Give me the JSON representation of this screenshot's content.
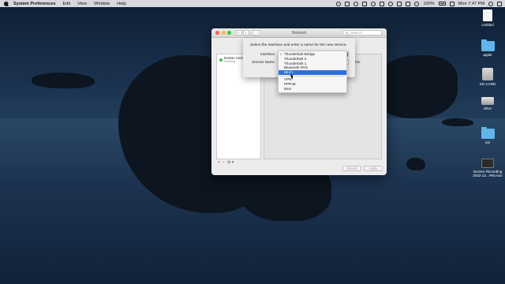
{
  "menubar": {
    "app_name": "System Preferences",
    "items": [
      "Edit",
      "View",
      "Window",
      "Help"
    ],
    "battery": "100%",
    "clock": "Mon 7:47 PM"
  },
  "desktop_icons": [
    {
      "label": "Untitled",
      "icon": "document-icon"
    },
    {
      "label": "apple",
      "icon": "folder-icon"
    },
    {
      "label": "SD CARD",
      "icon": "sd-card-icon"
    },
    {
      "label": "drive",
      "icon": "drive-icon"
    },
    {
      "label": "car",
      "icon": "folder-icon"
    },
    {
      "label": "Screen Recording 2022-12...PM.mov",
      "icon": "video-file-icon"
    }
  ],
  "window": {
    "title": "Network",
    "search_placeholder": "Search",
    "services": [
      {
        "name": "Norton AntiVi...",
        "status": "Running"
      }
    ],
    "sidebar_tools": [
      "+",
      "−",
      "⚙ ▾"
    ],
    "filter_label": "filter",
    "buttons": {
      "revert": "Revert",
      "apply": "Apply"
    }
  },
  "sheet": {
    "prompt": "Select the interface and enter a name for the new service.",
    "interface_label": "Interface",
    "service_name_label": "Service Name"
  },
  "interface_menu": {
    "items": [
      "Thunderbolt Bridge",
      "Thunderbolt 2",
      "Thunderbolt 1",
      "Bluetooth PAN",
      "Wi-Fi",
      "VPN",
      "PPPoE",
      "6to4"
    ],
    "checked": "Thunderbolt Bridge",
    "highlighted": "Wi-Fi"
  },
  "colors": {
    "accent": "#2f70de",
    "status_green": "#3fc24b",
    "close": "#fc605c",
    "minimize": "#fdbc40",
    "zoom": "#34c84a"
  }
}
